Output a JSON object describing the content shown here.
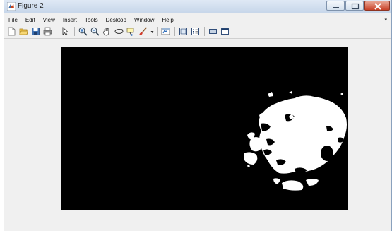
{
  "window": {
    "title": "Figure 2",
    "controls": [
      "minimize",
      "maximize",
      "close"
    ]
  },
  "menu": {
    "items": [
      {
        "label": "File"
      },
      {
        "label": "Edit"
      },
      {
        "label": "View"
      },
      {
        "label": "Insert"
      },
      {
        "label": "Tools"
      },
      {
        "label": "Desktop"
      },
      {
        "label": "Window"
      },
      {
        "label": "Help"
      }
    ],
    "overflow_arrow": "▾"
  },
  "toolbar": {
    "buttons": [
      "new-figure-icon",
      "open-file-icon",
      "save-icon",
      "print-icon",
      "edit-plot-icon",
      "zoom-in-icon",
      "zoom-out-icon",
      "pan-icon",
      "rotate-3d-icon",
      "data-cursor-icon",
      "brush-icon",
      "link-plot-icon",
      "insert-colorbar-icon",
      "insert-legend-icon",
      "hide-plot-tools-icon",
      "show-plot-tools-icon"
    ]
  },
  "figure": {
    "background_color": "#000000",
    "blob_color": "#ffffff"
  }
}
